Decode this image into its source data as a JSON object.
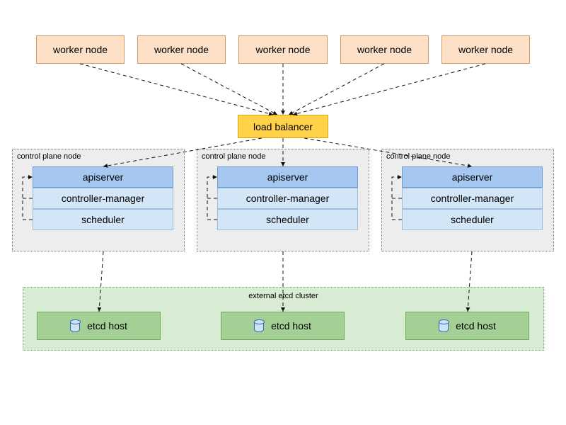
{
  "workers": {
    "label": "worker node"
  },
  "load_balancer": {
    "label": "load balancer"
  },
  "control_plane": {
    "title": "control plane node",
    "apiserver_label": "apiserver",
    "cm_label": "controller-manager",
    "scheduler_label": "scheduler"
  },
  "etcd": {
    "cluster_label": "external etcd cluster",
    "host_label": "etcd host"
  }
}
